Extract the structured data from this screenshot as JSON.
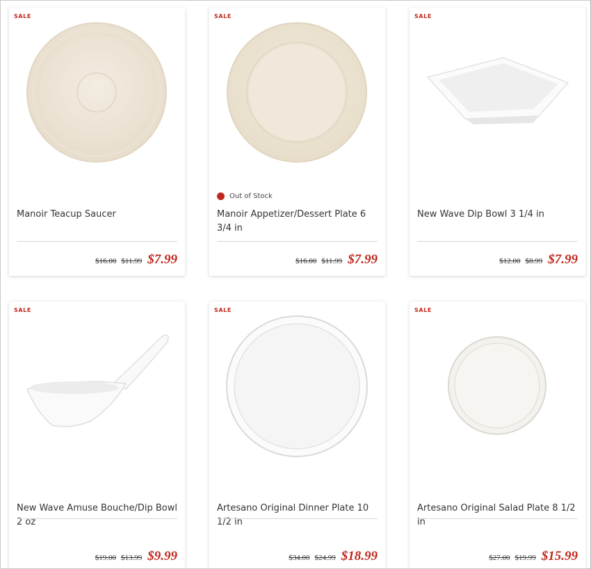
{
  "products": [
    {
      "badge": "SALE",
      "name": "Manoir Teacup Saucer",
      "stock": "",
      "price_orig": "$16.00",
      "price_prev": "$11.99",
      "price_now": "$7.99",
      "image": "manoir-saucer"
    },
    {
      "badge": "SALE",
      "name": "Manoir Appetizer/Dessert Plate 6 3/4 in",
      "stock": "Out of Stock",
      "price_orig": "$16.00",
      "price_prev": "$11.99",
      "price_now": "$7.99",
      "image": "manoir-plate"
    },
    {
      "badge": "SALE",
      "name": "New Wave Dip Bowl 3 1/4 in",
      "stock": "",
      "price_orig": "$12.00",
      "price_prev": "$8.99",
      "price_now": "$7.99",
      "image": "new-wave-dip-bowl"
    },
    {
      "badge": "SALE",
      "name": "New Wave Amuse Bouche/Dip Bowl 2 oz",
      "stock": "",
      "price_orig": "$19.00",
      "price_prev": "$13.99",
      "price_now": "$9.99",
      "image": "amuse-bouche-spoon"
    },
    {
      "badge": "SALE",
      "name": "Artesano Original Dinner Plate 10 1/2 in",
      "stock": "",
      "price_orig": "$34.00",
      "price_prev": "$24.99",
      "price_now": "$18.99",
      "image": "artesano-dinner-plate"
    },
    {
      "badge": "SALE",
      "name": "Artesano Original Salad Plate 8 1/2 in",
      "stock": "",
      "price_orig": "$27.00",
      "price_prev": "$19.99",
      "price_now": "$15.99",
      "image": "artesano-salad-plate"
    }
  ],
  "colors": {
    "sale_red": "#c0271c",
    "text": "#333333",
    "rule": "#d6d6d6"
  }
}
